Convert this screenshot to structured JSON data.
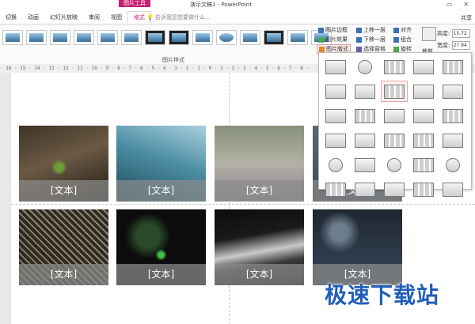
{
  "titlebar": {
    "context_tab_group": "图片工具",
    "title": "演示文稿1 - PowerPoint",
    "minimize_symbol": "▭",
    "close_symbol": "✕"
  },
  "tabs": [
    "切换",
    "动画",
    "幻灯片放映",
    "审阅",
    "视图",
    "格式"
  ],
  "active_tab": "格式",
  "tellme": {
    "placeholder": "告诉我您想要做什么..."
  },
  "share_label": "共享",
  "ribbon": {
    "picture_styles_group_label": "图片样式",
    "picture_border": "图片边框",
    "picture_effects": "图片效果",
    "picture_layout": "图片版式",
    "bring_forward": "上移一层",
    "send_backward": "下移一层",
    "selection_pane": "选择窗格",
    "align": "对齐",
    "group": "组合",
    "rotate": "旋转",
    "crop": "裁剪",
    "height_label": "高度:",
    "height_value": "15.72",
    "width_label": "宽度:",
    "width_value": "27.94"
  },
  "ruler_text": "· 16 · 15 · 14 · 13 · 12 · 11 · 10 · 9 · 8 · 7 · 6 · 5 · 4 · 3 · 2 · 1 · 0 · 1 · 2 · 3 · 4 · 5 · 6 · 7 · 8 ·",
  "slide": {
    "captions": [
      "[文本]",
      "[文本]",
      "[文本]",
      "[文本]",
      "[文本]",
      "[文本]",
      "[文本]",
      "[文本]"
    ]
  },
  "colors": {
    "accent": "#c61d72",
    "watermark": "#1f5fb8"
  },
  "watermark": "极速下载站"
}
